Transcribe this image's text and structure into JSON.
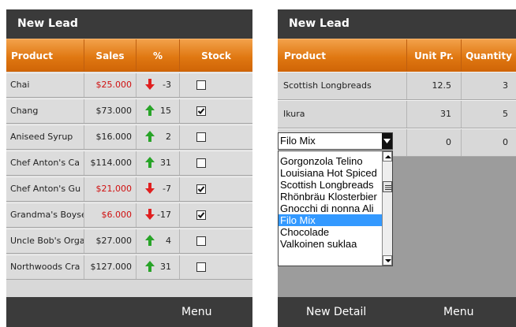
{
  "screen1": {
    "title": "New Lead",
    "columns": [
      "Product",
      "Sales",
      "%",
      "Stock"
    ],
    "rows": [
      {
        "product": "Chai",
        "sales": "$25.000",
        "sales_negative": true,
        "trend": "down",
        "pct": "-3",
        "stock": false
      },
      {
        "product": "Chang",
        "sales": "$73.000",
        "sales_negative": false,
        "trend": "up",
        "pct": "15",
        "stock": true
      },
      {
        "product": "Aniseed Syrup",
        "sales": "$16.000",
        "sales_negative": false,
        "trend": "up",
        "pct": "2",
        "stock": false
      },
      {
        "product": "Chef Anton's Ca",
        "sales": "$114.000",
        "sales_negative": false,
        "trend": "up",
        "pct": "31",
        "stock": false
      },
      {
        "product": "Chef Anton's Gu",
        "sales": "$21,000",
        "sales_negative": true,
        "trend": "down",
        "pct": "-7",
        "stock": true
      },
      {
        "product": "Grandma's Boyse",
        "sales": "$6.000",
        "sales_negative": true,
        "trend": "down",
        "pct": "-17",
        "stock": true
      },
      {
        "product": "Uncle Bob's Orga",
        "sales": "$27.000",
        "sales_negative": false,
        "trend": "up",
        "pct": "4",
        "stock": false
      },
      {
        "product": "Northwoods Cra",
        "sales": "$127.000",
        "sales_negative": false,
        "trend": "up",
        "pct": "31",
        "stock": false
      }
    ],
    "menu_label": "Menu"
  },
  "screen2": {
    "title": "New Lead",
    "columns": [
      "Product",
      "Unit Pr.",
      "Quantity"
    ],
    "rows": [
      {
        "product": "Scottish Longbreads",
        "unit_price": "12.5",
        "quantity": "3"
      },
      {
        "product": "Ikura",
        "unit_price": "31",
        "quantity": "5"
      },
      {
        "product": "",
        "unit_price": "0",
        "quantity": "0"
      }
    ],
    "combo_value": "Filo Mix",
    "dropdown_options": [
      "Gorgonzola Telino",
      "Louisiana Hot Spiced",
      "Scottish Longbreads",
      "Rhönbräu Klosterbier",
      "Gnocchi di nonna Ali",
      "Filo Mix",
      "Chocolade",
      "Valkoinen suklaa"
    ],
    "dropdown_selected_index": 5,
    "left_softkey": "New Detail",
    "right_softkey": "Menu"
  },
  "colors": {
    "header_orange": "#e07812",
    "title_bar": "#3a3a3a",
    "negative_red": "#d01010",
    "up_arrow_green": "#28a428",
    "down_arrow_red": "#e02020",
    "selection_blue": "#3399ff"
  },
  "icons": {
    "up": "arrow-up-icon",
    "down": "arrow-down-icon",
    "check": "checkmark-icon",
    "combo": "dropdown-arrow-icon"
  }
}
